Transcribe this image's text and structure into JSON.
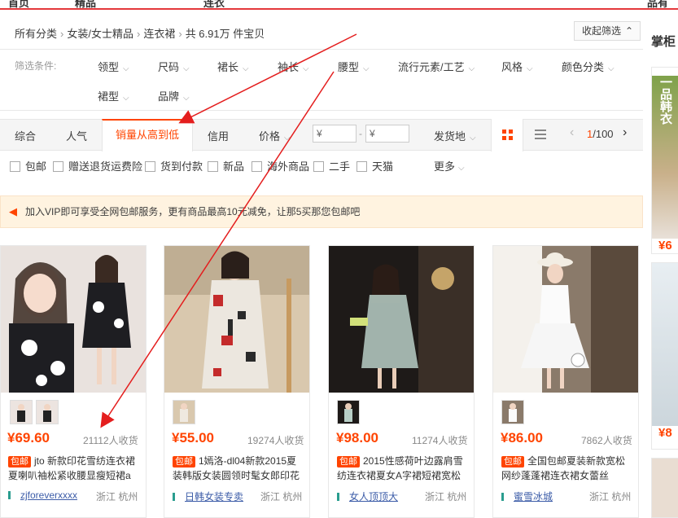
{
  "top_nav": {
    "items": [
      "首页",
      "精品",
      "连衣",
      "品有"
    ]
  },
  "breadcrumb": {
    "items": [
      "所有分类",
      "女装/女士精品",
      "连衣裙"
    ],
    "separator": "›",
    "count_text": "共 6.91万 件宝贝"
  },
  "collapse_filter": {
    "label": "收起筛选",
    "chevron": "⌃"
  },
  "filters": {
    "label": "筛选条件:",
    "row1": [
      "领型",
      "尺码",
      "裙长",
      "袖长",
      "腰型",
      "流行元素/工艺",
      "风格",
      "颜色分类"
    ],
    "row2": [
      "裙型",
      "品牌"
    ]
  },
  "sort": {
    "tabs": [
      "综合",
      "人气",
      "销量从高到低",
      "信用",
      "价格"
    ],
    "active": "销量从高到低",
    "price_min_placeholder": "¥",
    "price_max_placeholder": "¥",
    "price_dash": "-",
    "ship_from": "发货地",
    "page_current": "1",
    "page_total": "/100",
    "prev": "‹",
    "next": "›"
  },
  "checkboxes": [
    "包邮",
    "赠送退货运费险",
    "货到付款",
    "新品",
    "海外商品",
    "二手",
    "天猫"
  ],
  "more": "更多",
  "vip_banner": "加入VIP即可享受全网包邮服务，更有商品最高10元减免，让那5买那您包邮吧",
  "products": [
    {
      "price": "¥69.60",
      "sold": "21112人收货",
      "tag": "包邮",
      "title1": "jto 新款印花雪纺连衣裙",
      "title2": "夏喇叭袖松紧收腰显瘦短裙a",
      "shop": "zjforeverxxxx",
      "location": "浙江 杭州"
    },
    {
      "price": "¥55.00",
      "sold": "19274人收货",
      "tag": "包邮",
      "title1": "1嫣洛-dl04新款2015夏",
      "title2": "装韩版女装圆领时髦女郎印花",
      "shop": "日韩女装专卖",
      "location": "浙江 杭州"
    },
    {
      "price": "¥98.00",
      "sold": "11274人收货",
      "tag": "包邮",
      "title1": "2015性感荷叶边露肩雪",
      "title2": "纺连衣裙夏女A字裙短裙宽松",
      "shop": "女人顶顶大",
      "location": "浙江 杭州"
    },
    {
      "price": "¥86.00",
      "sold": "7862人收货",
      "tag": "包邮",
      "title1": "全国包邮夏装新款宽松",
      "title2": "网纱蓬蓬裙连衣裙女蕾丝",
      "shop": "蜜雪冰城",
      "location": "浙江 杭州"
    }
  ],
  "sidebar": {
    "title": "掌柜",
    "banner_text": "一品韩衣",
    "price1": "¥6",
    "price2": "¥8"
  },
  "colors": {
    "accent": "#ff4400",
    "arrow": "#e41e1e",
    "shop_link": "#3c5ca8"
  }
}
